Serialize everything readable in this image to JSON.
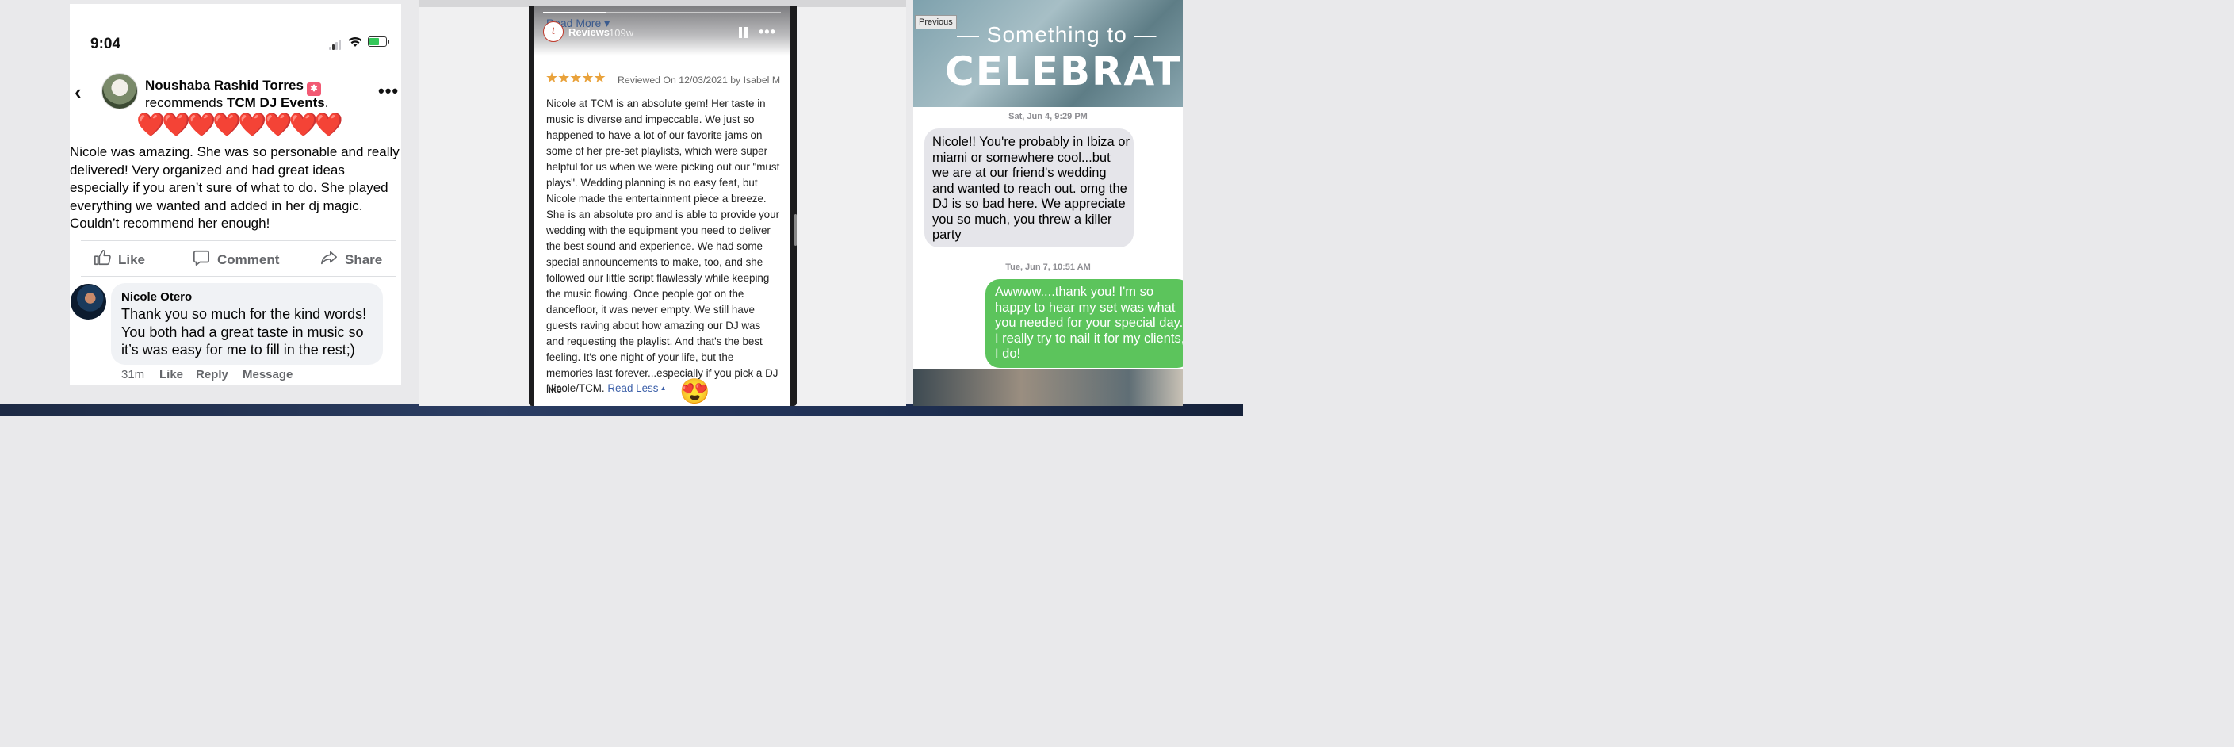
{
  "facebook_post": {
    "status_time": "9:04",
    "poster_name": "Noushaba Rashid Torres",
    "recommends_prefix": "recommends ",
    "page_name": "TCM DJ Events",
    "recommends_suffix": ".",
    "hearts": "❤️❤️❤️❤️❤️❤️❤️❤️",
    "review_text": "Nicole was amazing. She was so personable and really delivered! Very organized and had great ideas especially if you aren’t sure of what to do. She played everything we wanted and added in her dj magic. Couldn’t recommend her enough!",
    "actions": {
      "like": "Like",
      "comment": "Comment",
      "share": "Share"
    },
    "comment": {
      "author": "Nicole Otero",
      "text": "Thank you so much for the kind words! You both had a great taste in music so it’s was easy for me to fill in the rest;)",
      "time": "31m",
      "like": "Like",
      "reply": "Reply",
      "message": "Message"
    }
  },
  "review_story": {
    "read_more": "Read More",
    "logo_letter": "t",
    "title": "Reviews",
    "age": "109w",
    "stars": "★★★★★",
    "reviewed_on": "Reviewed On 12/03/2021 by Isabel M",
    "text": "Nicole at TCM is an absolute gem! Her taste in music is diverse and impeccable. We just so happened to have a lot of our favorite jams on some of her pre-set playlists, which were super helpful for us when we were picking out our \"must plays\". Wedding planning is no easy feat, but Nicole made the entertainment piece a breeze. She is an absolute pro and is able to provide your wedding with the equipment you need to deliver the best sound and experience. We had some special announcements to make, too, and she followed our little script flawlessly while keeping the music flowing. Once people got on the dancefloor, it was never empty. We still have guests raving about how amazing our DJ was and requesting the playlist. And that's the best feeling. It's one night of your life, but the memories last forever...especially if you pick a DJ like",
    "text_end": "Nicole/TCM. ",
    "read_less": "Read Less",
    "emoji": "😍",
    "rating": 5
  },
  "text_thread": {
    "previous": "Previous",
    "banner_line1": "— Something to —",
    "banner_line2": "CELEBRATE",
    "timestamp1": "Sat, Jun 4, 9:29 PM",
    "received": "Nicole!! You're probably in Ibiza or miami or somewhere cool...but we are at our friend's wedding and wanted to reach out. omg the DJ is so bad here. We appreciate you so much, you threw a killer party",
    "timestamp2": "Tue, Jun 7, 10:51 AM",
    "sent": "Awwww....thank you!  I'm so happy to hear my set was what you needed for your special day. I really try to nail it for my clients, I do!"
  },
  "colors": {
    "facebook_gray": "#65676b",
    "star_orange": "#e9a23b",
    "imessage_green": "#5cc45c",
    "imessage_gray": "#e5e5ea"
  }
}
